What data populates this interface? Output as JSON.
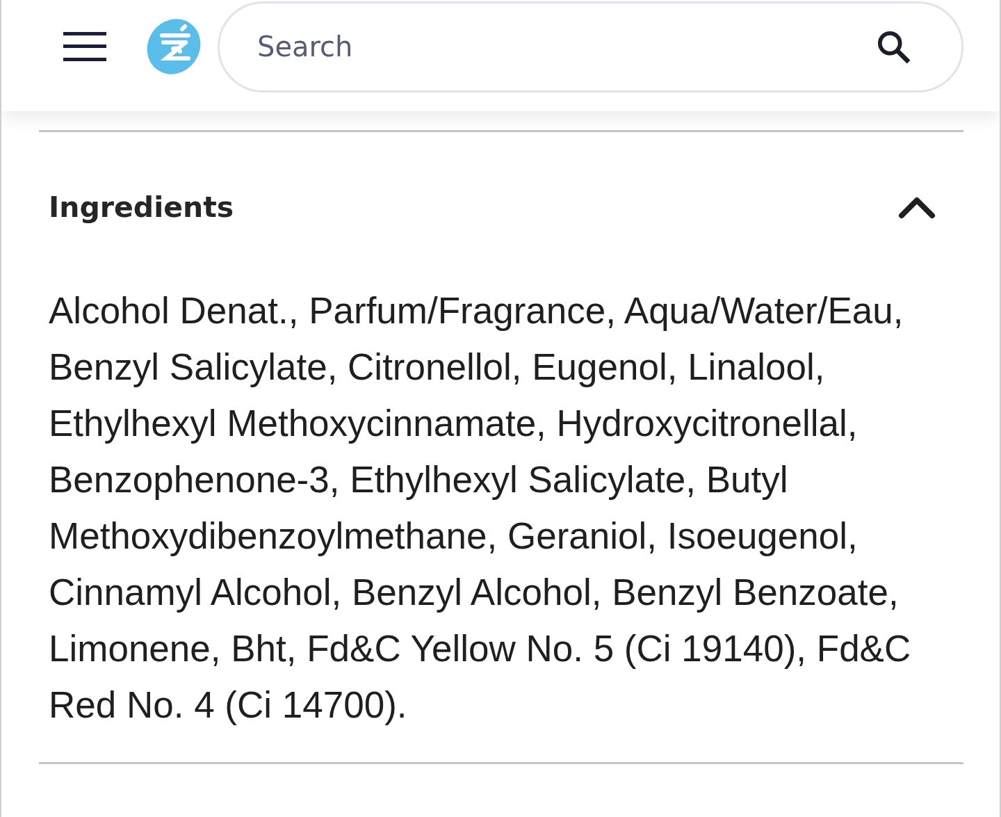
{
  "header": {
    "search": {
      "placeholder": "Search"
    }
  },
  "section": {
    "title": "Ingredients",
    "expanded": true,
    "body": "Alcohol Denat., Parfum/Fragrance, Aqua/Water/Eau, Benzyl Salicylate, Citronellol, Eugenol, Linalool, Ethylhexyl Methoxycinnamate, Hydroxycitronellal, Benzophenone-3, Ethylhexyl Salicylate, Butyl Methoxydibenzoylmethane, Geraniol, Isoeugenol, Cinnamyl Alcohol, Benzyl Alcohol, Benzyl Benzoate, Limonene, Bht, Fd&C Yellow No. 5 (Ci 19140), Fd&C Red No. 4 (Ci 14700)."
  }
}
